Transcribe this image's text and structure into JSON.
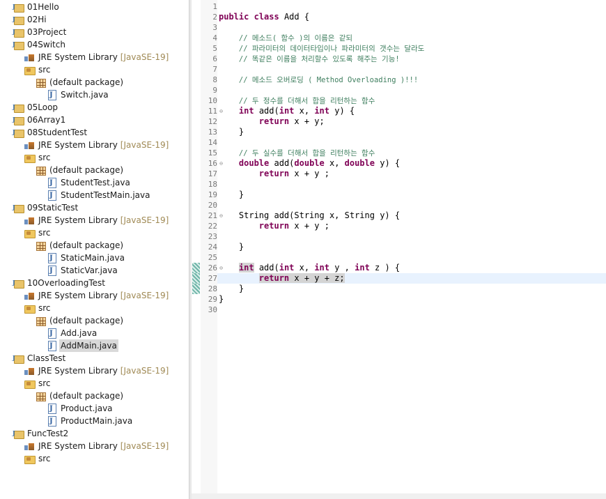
{
  "explorer": {
    "items": [
      {
        "arrow": "›",
        "icon": "project-icon",
        "label": "01Hello",
        "decor": ""
      },
      {
        "arrow": "›",
        "icon": "project-icon",
        "label": "02Hi",
        "decor": ""
      },
      {
        "arrow": "›",
        "icon": "project-icon",
        "label": "03Project",
        "decor": ""
      },
      {
        "arrow": "⌄",
        "icon": "project-icon",
        "label": "04Switch",
        "decor": ""
      },
      {
        "arrow": "›",
        "icon": "library-icon",
        "label": "JRE System Library",
        "decor": "[JavaSE-19]"
      },
      {
        "arrow": "⌄",
        "icon": "source-folder-icon",
        "label": "src",
        "decor": ""
      },
      {
        "arrow": "⌄",
        "icon": "package-icon",
        "label": "(default package)",
        "decor": ""
      },
      {
        "arrow": "›",
        "icon": "java-file-icon",
        "label": "Switch.java",
        "decor": ""
      },
      {
        "arrow": "›",
        "icon": "project-icon",
        "label": "05Loop",
        "decor": ""
      },
      {
        "arrow": "›",
        "icon": "project-icon",
        "label": "06Array1",
        "decor": ""
      },
      {
        "arrow": "⌄",
        "icon": "project-icon",
        "label": "08StudentTest",
        "decor": ""
      },
      {
        "arrow": "›",
        "icon": "library-icon",
        "label": "JRE System Library",
        "decor": "[JavaSE-19]"
      },
      {
        "arrow": "⌄",
        "icon": "source-folder-icon",
        "label": "src",
        "decor": ""
      },
      {
        "arrow": "⌄",
        "icon": "package-icon",
        "label": "(default package)",
        "decor": ""
      },
      {
        "arrow": "›",
        "icon": "java-file-icon",
        "label": "StudentTest.java",
        "decor": ""
      },
      {
        "arrow": "›",
        "icon": "java-file-icon",
        "label": "StudentTestMain.java",
        "decor": ""
      },
      {
        "arrow": "⌄",
        "icon": "project-icon",
        "label": "09StaticTest",
        "decor": ""
      },
      {
        "arrow": "›",
        "icon": "library-icon",
        "label": "JRE System Library",
        "decor": "[JavaSE-19]"
      },
      {
        "arrow": "⌄",
        "icon": "source-folder-icon",
        "label": "src",
        "decor": ""
      },
      {
        "arrow": "⌄",
        "icon": "package-icon",
        "label": "(default package)",
        "decor": ""
      },
      {
        "arrow": "›",
        "icon": "java-file-icon",
        "label": "StaticMain.java",
        "decor": ""
      },
      {
        "arrow": "›",
        "icon": "java-file-icon",
        "label": "StaticVar.java",
        "decor": ""
      },
      {
        "arrow": "⌄",
        "icon": "project-icon",
        "label": "10OverloadingTest",
        "decor": ""
      },
      {
        "arrow": "›",
        "icon": "library-icon",
        "label": "JRE System Library",
        "decor": "[JavaSE-19]"
      },
      {
        "arrow": "⌄",
        "icon": "source-folder-icon",
        "label": "src",
        "decor": ""
      },
      {
        "arrow": "⌄",
        "icon": "package-icon",
        "label": "(default package)",
        "decor": ""
      },
      {
        "arrow": "›",
        "icon": "java-file-icon",
        "label": "Add.java",
        "decor": ""
      },
      {
        "arrow": "›",
        "icon": "java-file-icon",
        "label": "AddMain.java",
        "decor": "",
        "selected": true
      },
      {
        "arrow": "⌄",
        "icon": "project-icon",
        "label": "ClassTest",
        "decor": ""
      },
      {
        "arrow": "›",
        "icon": "library-icon",
        "label": "JRE System Library",
        "decor": "[JavaSE-19]"
      },
      {
        "arrow": "⌄",
        "icon": "source-folder-icon",
        "label": "src",
        "decor": ""
      },
      {
        "arrow": "⌄",
        "icon": "package-icon",
        "label": "(default package)",
        "decor": ""
      },
      {
        "arrow": "›",
        "icon": "java-file-icon",
        "label": "Product.java",
        "decor": ""
      },
      {
        "arrow": "›",
        "icon": "java-file-icon",
        "label": "ProductMain.java",
        "decor": ""
      },
      {
        "arrow": "⌄",
        "icon": "project-icon",
        "label": "FuncTest2",
        "decor": ""
      },
      {
        "arrow": "›",
        "icon": "library-icon",
        "label": "JRE System Library",
        "decor": "[JavaSE-19]"
      },
      {
        "arrow": "›",
        "icon": "source-folder-icon",
        "label": "src",
        "decor": ""
      }
    ]
  },
  "editor": {
    "lines": [
      {
        "n": "1",
        "code": ""
      },
      {
        "n": "2",
        "code": "public class Add {"
      },
      {
        "n": "3",
        "code": ""
      },
      {
        "n": "4",
        "code": "    // 메소드( 함수 )의 이름은 같되"
      },
      {
        "n": "5",
        "code": "    // 파라미터의 데이터타입이나 파라미터의 갯수는 달라도"
      },
      {
        "n": "6",
        "code": "    // 똑같은 이름을 처리할수 있도록 해주는 기능!"
      },
      {
        "n": "7",
        "code": ""
      },
      {
        "n": "8",
        "code": "    // 메소드 오버로딩 ( Method Overloading )!!!"
      },
      {
        "n": "9",
        "code": ""
      },
      {
        "n": "10",
        "code": "    // 두 정수를 더해서 합을 리턴하는 함수"
      },
      {
        "n": "11",
        "code": "    int add(int x, int y) {",
        "fold": "⊖"
      },
      {
        "n": "12",
        "code": "        return x + y;"
      },
      {
        "n": "13",
        "code": "    }"
      },
      {
        "n": "14",
        "code": ""
      },
      {
        "n": "15",
        "code": "    // 두 실수를 더해서 합을 리턴하는 함수"
      },
      {
        "n": "16",
        "code": "    double add(double x, double y) {",
        "fold": "⊖"
      },
      {
        "n": "17",
        "code": "        return x + y ;"
      },
      {
        "n": "18",
        "code": ""
      },
      {
        "n": "19",
        "code": "    }"
      },
      {
        "n": "20",
        "code": ""
      },
      {
        "n": "21",
        "code": "    String add(String x, String y) {",
        "fold": "⊖"
      },
      {
        "n": "22",
        "code": "        return x + y ;"
      },
      {
        "n": "23",
        "code": ""
      },
      {
        "n": "24",
        "code": "    }"
      },
      {
        "n": "25",
        "code": ""
      },
      {
        "n": "26",
        "code": "    int add(int x, int y , int z ) {",
        "fold": "⊖",
        "changed": true,
        "hl": "int"
      },
      {
        "n": "27",
        "code": "        return x + y + z;",
        "changed": true,
        "current": true,
        "hl": "return x + y + z;"
      },
      {
        "n": "28",
        "code": "    }",
        "changed": true
      },
      {
        "n": "29",
        "code": "}"
      },
      {
        "n": "30",
        "code": ""
      }
    ]
  },
  "colors": {
    "keyword": "#7f0055",
    "comment": "#3f7f5f",
    "current_line": "#e8f2fe",
    "decoration": "#a08a55"
  }
}
